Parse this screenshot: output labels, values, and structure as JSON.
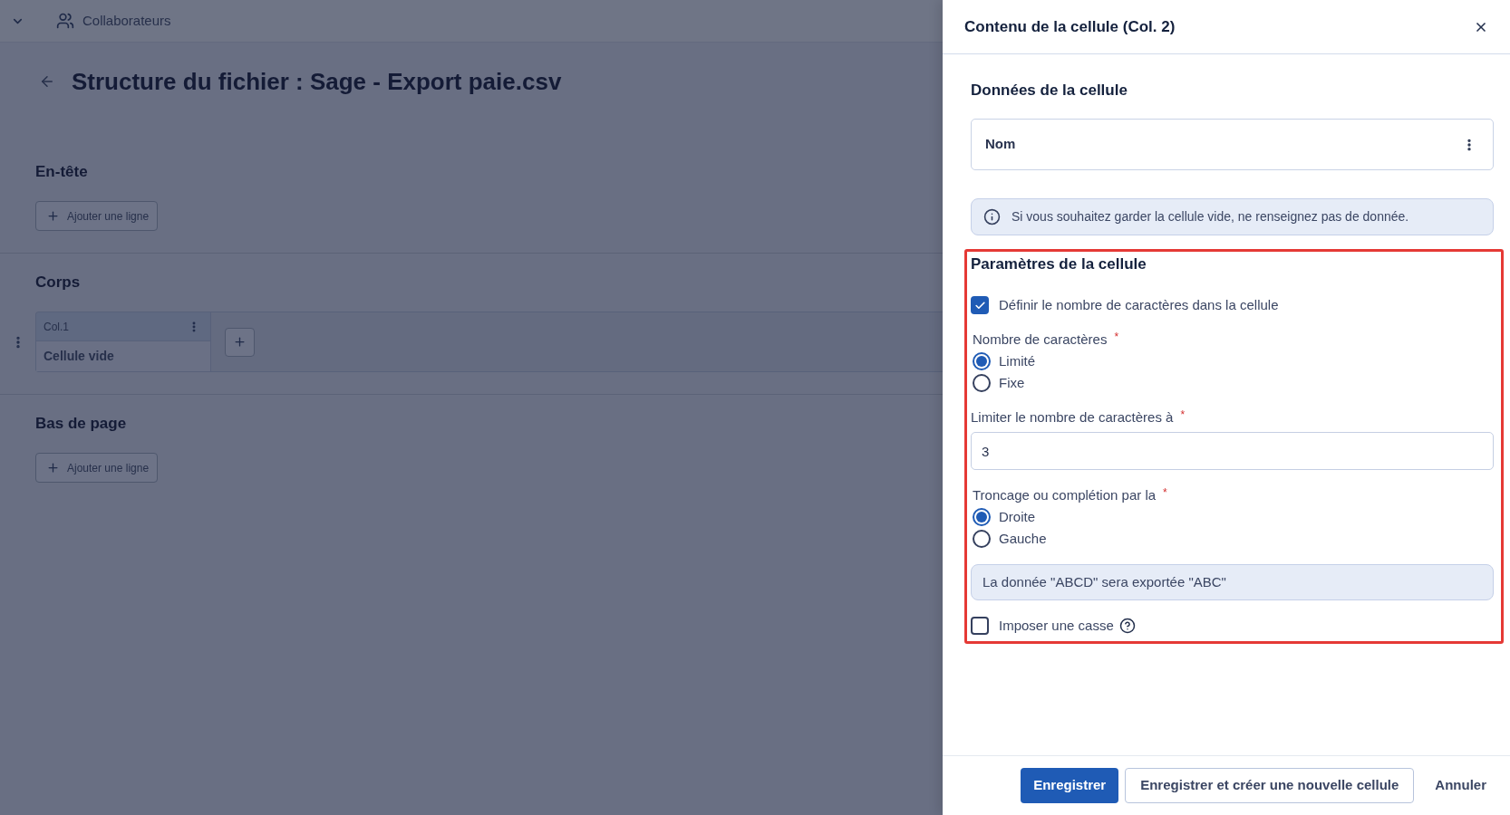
{
  "top_bar": {
    "nav_label": "Collaborateurs"
  },
  "page": {
    "title": "Structure du fichier : Sage - Export paie.csv",
    "sections": [
      {
        "kind": "lines",
        "title": "En-tête",
        "button": "Ajouter une ligne"
      },
      {
        "kind": "table",
        "title": "Corps",
        "columns": [
          {
            "header": "Col.1",
            "cell": "Cellule vide"
          }
        ]
      },
      {
        "kind": "lines",
        "title": "Bas de page",
        "button": "Ajouter une ligne"
      }
    ]
  },
  "panel": {
    "title": "Contenu de la cellule (Col. 2)",
    "data_section": {
      "title": "Données de la cellule",
      "value": "Nom",
      "info": "Si vous souhaitez garder la cellule vide, ne renseignez pas de donnée."
    },
    "params": {
      "title": "Paramètres de la cellule",
      "highlighted": true,
      "items": [
        {
          "kind": "checkbox",
          "label": "Définir le nombre de caractères dans la cellule",
          "checked": true
        },
        {
          "kind": "radio_group",
          "label": "Nombre de caractères",
          "required_mark": "*",
          "options": [
            {
              "label": "Limité",
              "selected": true
            },
            {
              "label": "Fixe",
              "selected": false
            }
          ]
        },
        {
          "kind": "text_field",
          "label": "Limiter le nombre de caractères à",
          "required_mark": "*",
          "value": "3"
        },
        {
          "kind": "radio_group",
          "label": "Troncage ou complétion par la",
          "required_mark": "*",
          "options": [
            {
              "label": "Droite",
              "selected": true
            },
            {
              "label": "Gauche",
              "selected": false
            }
          ]
        },
        {
          "kind": "note",
          "text": "La donnée \"ABCD\" sera exportée \"ABC\""
        },
        {
          "kind": "checkbox",
          "label": "Imposer une casse",
          "checked": false,
          "help": true
        }
      ]
    },
    "buttons": [
      {
        "kind": "primary",
        "label": "Enregistrer"
      },
      {
        "kind": "secondary",
        "label": "Enregistrer et créer une nouvelle cellule"
      },
      {
        "kind": "link",
        "label": "Annuler"
      }
    ]
  }
}
